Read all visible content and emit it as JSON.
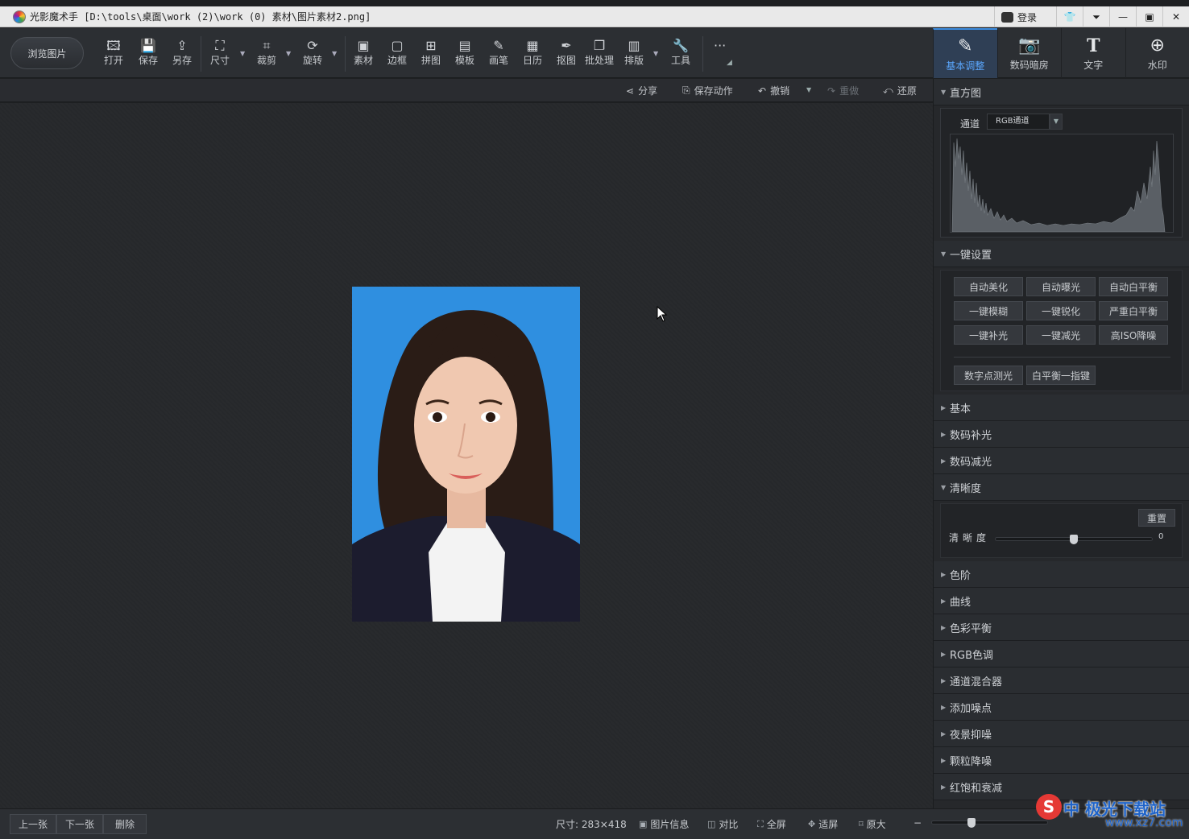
{
  "window": {
    "title": "光影魔术手  [D:\\tools\\桌面\\work (2)\\work (0) 素材\\图片素材2.png]",
    "login": "登录"
  },
  "toolbar": {
    "browse": "浏览图片",
    "tools": [
      {
        "label": "打开",
        "icon": "open-icon"
      },
      {
        "label": "保存",
        "icon": "save-icon"
      },
      {
        "label": "另存",
        "icon": "save-as-icon"
      },
      {
        "label": "尺寸",
        "icon": "resize-icon"
      },
      {
        "label": "裁剪",
        "icon": "crop-icon"
      },
      {
        "label": "旋转",
        "icon": "rotate-icon"
      },
      {
        "label": "素材",
        "icon": "material-icon"
      },
      {
        "label": "边框",
        "icon": "border-icon"
      },
      {
        "label": "拼图",
        "icon": "collage-icon"
      },
      {
        "label": "模板",
        "icon": "template-icon"
      },
      {
        "label": "画笔",
        "icon": "brush-icon"
      },
      {
        "label": "日历",
        "icon": "calendar-icon"
      },
      {
        "label": "抠图",
        "icon": "cutout-icon"
      },
      {
        "label": "批处理",
        "icon": "batch-icon"
      },
      {
        "label": "排版",
        "icon": "layout-icon"
      },
      {
        "label": "工具",
        "icon": "wrench-icon"
      }
    ],
    "more": "···"
  },
  "tabs": [
    {
      "label": "基本调整",
      "icon": "basic-adjust-icon"
    },
    {
      "label": "数码暗房",
      "icon": "darkroom-icon"
    },
    {
      "label": "文字",
      "icon": "text-icon"
    },
    {
      "label": "水印",
      "icon": "watermark-icon"
    }
  ],
  "subtoolbar": {
    "share": "分享",
    "save_action": "保存动作",
    "undo": "撤销",
    "redo": "重做",
    "restore": "还原"
  },
  "panel": {
    "histogram": {
      "title": "直方图",
      "channel_label": "通道",
      "channel_value": "RGB通道"
    },
    "onekey": {
      "title": "一键设置",
      "buttons": [
        "自动美化",
        "自动曝光",
        "自动白平衡",
        "一键模糊",
        "一键锐化",
        "严重白平衡",
        "一键补光",
        "一键减光",
        "高ISO降噪"
      ],
      "extra": [
        "数字点测光",
        "白平衡一指键"
      ]
    },
    "sections_a": [
      "基本",
      "数码补光",
      "数码减光"
    ],
    "sharpness": {
      "title": "清晰度",
      "reset": "重置",
      "label": "清晰度",
      "value": "0",
      "slider_fraction": 0.5
    },
    "sections_b": [
      "色阶",
      "曲线",
      "色彩平衡",
      "RGB色调",
      "通道混合器",
      "添加噪点",
      "夜景抑噪",
      "颗粒降噪",
      "红饱和衰减"
    ]
  },
  "statusbar": {
    "prev": "上一张",
    "next": "下一张",
    "delete": "删除",
    "size": "尺寸: 283×418",
    "info": "图片信息",
    "compare": "对比",
    "fullscreen": "全屏",
    "fit": "适屏",
    "original": "原大",
    "zoom_minus": "−",
    "zoom_fraction": 0.33
  },
  "watermark_overlay": {
    "site": "极光下载站",
    "url": "www.xz7.com",
    "ime": "中"
  }
}
